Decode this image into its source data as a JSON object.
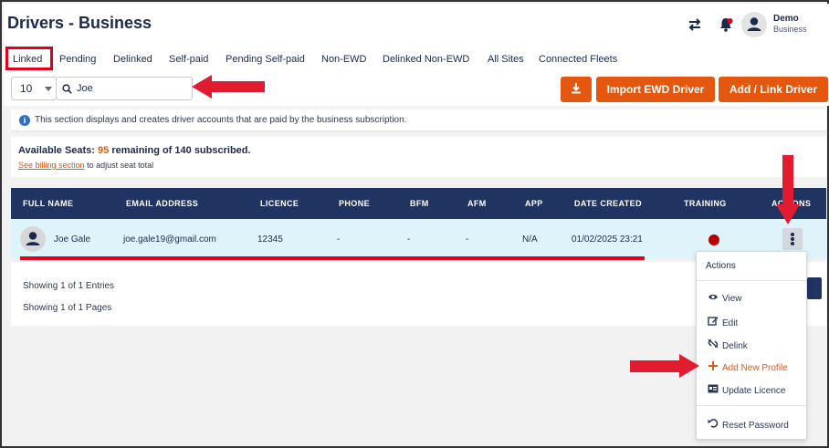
{
  "header": {
    "title": "Drivers - Business",
    "user_name": "Demo",
    "user_org": "Business",
    "icons": [
      "switch-arrows-icon",
      "bell-icon",
      "user-avatar-icon"
    ]
  },
  "tabs": [
    {
      "label": "Linked",
      "active": true
    },
    {
      "label": "Pending"
    },
    {
      "label": "Delinked"
    },
    {
      "label": "Self-paid"
    },
    {
      "label": "Pending Self-paid"
    },
    {
      "label": "Non-EWD"
    },
    {
      "label": "Delinked Non-EWD"
    },
    {
      "label": "All Sites"
    },
    {
      "label": "Connected Fleets"
    }
  ],
  "toolbar": {
    "page_size": "10",
    "search_value": "Joe",
    "import_label": "Import EWD Driver",
    "add_label": "Add / Link Driver"
  },
  "info": {
    "icon": "i",
    "text": "This section displays and creates driver accounts that are paid by the business subscription."
  },
  "seats": {
    "prefix": "Available Seats:",
    "remaining": "95",
    "suffix": "remaining of 140 subscribed.",
    "link": "See billing section",
    "link_suffix": "to adjust seat total"
  },
  "table": {
    "columns": [
      "FULL NAME",
      "EMAIL ADDRESS",
      "LICENCE",
      "PHONE",
      "BFM",
      "AFM",
      "APP",
      "DATE CREATED",
      "TRAINING",
      "ACTIONS"
    ],
    "rows": [
      {
        "name": "Joe Gale",
        "email": "joe.gale19@gmail.com",
        "licence": "12345",
        "phone": "-",
        "bfm": "-",
        "afm": "-",
        "app": "N/A",
        "date": "01/02/2025 23:21",
        "training_status_color": "#b50000"
      }
    ],
    "entries_text": "Showing 1 of 1 Entries",
    "pages_text": "Showing 1 of 1 Pages"
  },
  "actions_menu": {
    "title": "Actions",
    "items": [
      {
        "label": "View",
        "icon": "eye-icon"
      },
      {
        "label": "Edit",
        "icon": "edit-icon"
      },
      {
        "label": "Delink",
        "icon": "unlink-icon"
      },
      {
        "label": "Add New Profile",
        "icon": "plus-icon",
        "highlight": true
      },
      {
        "label": "Update Licence",
        "icon": "id-card-icon"
      },
      {
        "label": "Reset Password",
        "icon": "undo-icon"
      }
    ]
  },
  "colors": {
    "brand_navy": "#1f3461",
    "accent_orange": "#e4570f",
    "annotation_red": "#e31b30",
    "row_highlight": "#dff3fa"
  }
}
